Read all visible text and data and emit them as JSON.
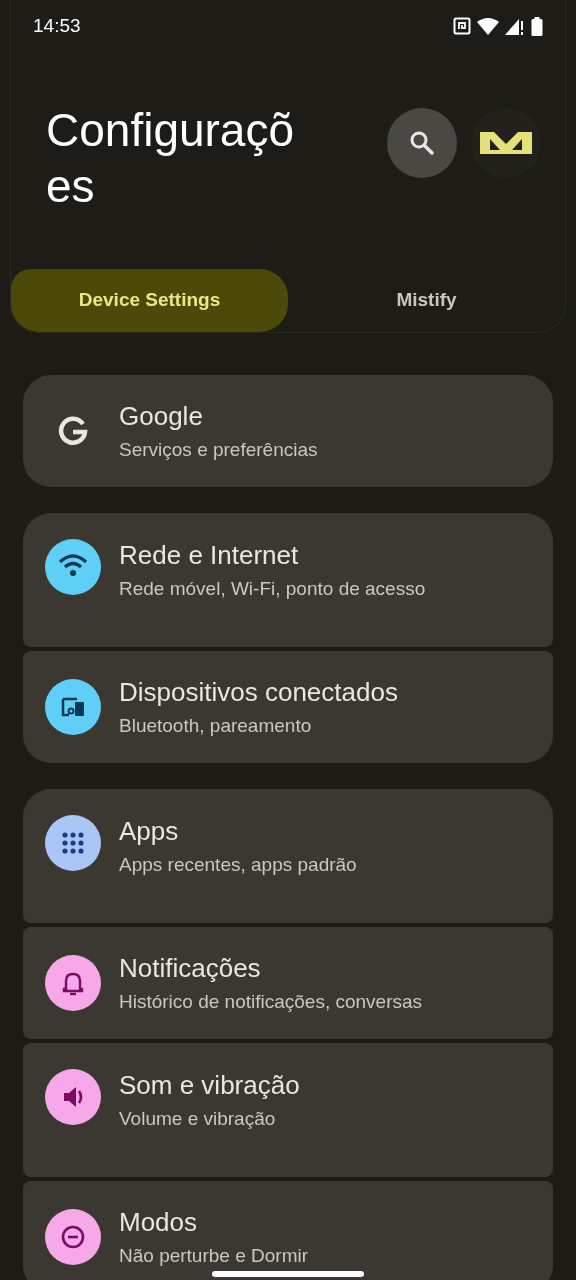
{
  "status_bar": {
    "time": "14:53"
  },
  "header": {
    "title": "Configurações"
  },
  "tabs": [
    {
      "label": "Device Settings",
      "selected": true
    },
    {
      "label": "Mistify",
      "selected": false
    }
  ],
  "groups": [
    {
      "items": [
        {
          "title": "Google",
          "subtitle": "Serviços e preferências"
        }
      ]
    },
    {
      "items": [
        {
          "title": "Rede e Internet",
          "subtitle": "Rede móvel, Wi-Fi, ponto de acesso",
          "color": "#5fcff7"
        },
        {
          "title": "Dispositivos conectados",
          "subtitle": "Bluetooth, pareamento",
          "color": "#5fcff7"
        }
      ]
    },
    {
      "items": [
        {
          "title": "Apps",
          "subtitle": "Apps recentes, apps padrão",
          "color": "#a9c6f7"
        },
        {
          "title": "Notificações",
          "subtitle": "Histórico de notificações, conversas",
          "color": "#f7a8e9"
        },
        {
          "title": "Som e vibração",
          "subtitle": "Volume e vibração",
          "color": "#f7a8e9"
        },
        {
          "title": "Modos",
          "subtitle": "Não perturbe e Dormir",
          "color": "#f7a8e9"
        }
      ]
    }
  ]
}
